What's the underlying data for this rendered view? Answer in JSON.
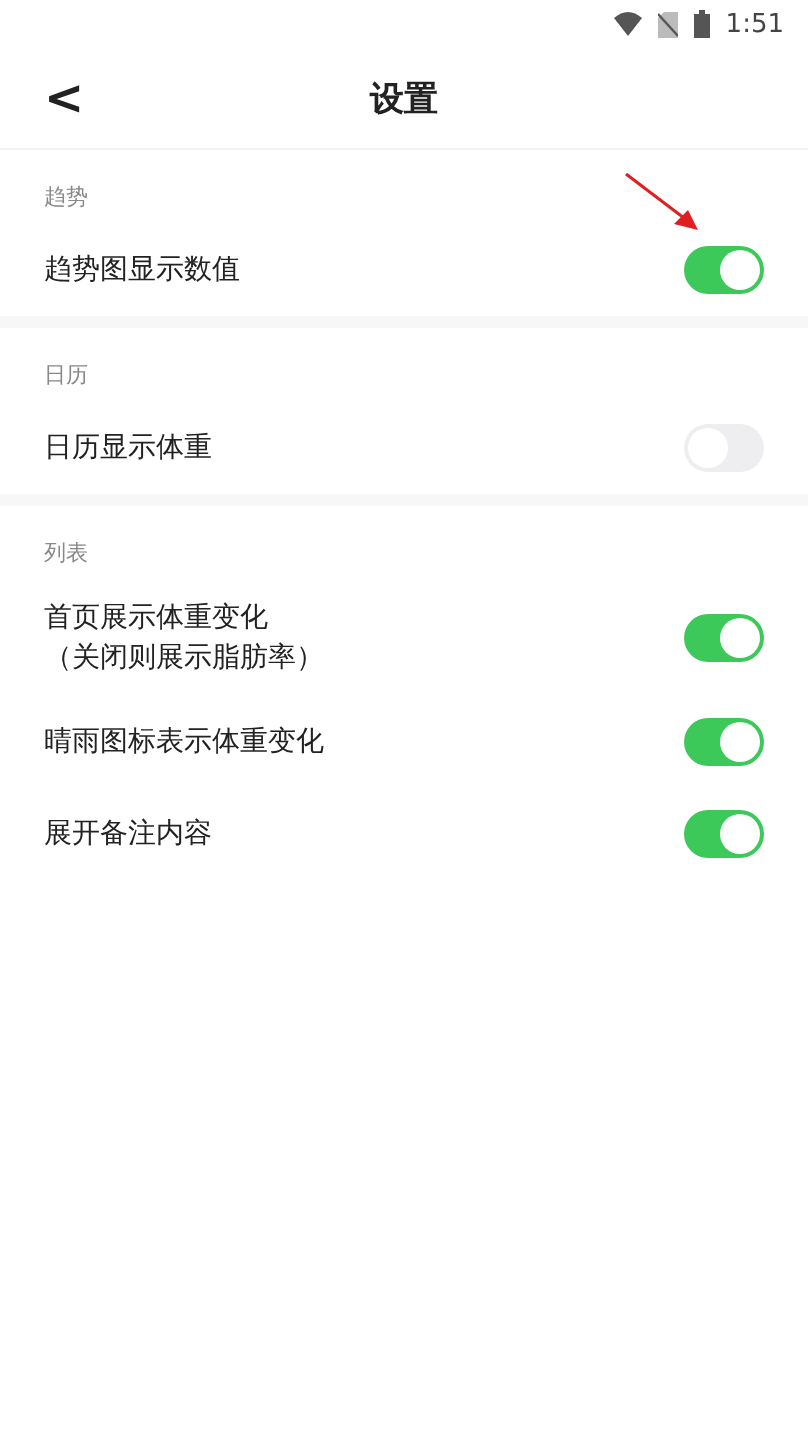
{
  "status_bar": {
    "time": "1:51"
  },
  "header": {
    "back": "<",
    "title": "设置"
  },
  "sections": [
    {
      "title": "趋势",
      "items": [
        {
          "label": "趋势图显示数值",
          "on": true,
          "annotated": true
        }
      ]
    },
    {
      "title": "日历",
      "items": [
        {
          "label": "日历显示体重",
          "on": false
        }
      ]
    },
    {
      "title": "列表",
      "items": [
        {
          "label": "首页展示体重变化",
          "note": "（关闭则展示脂肪率）",
          "on": true
        },
        {
          "label": "晴雨图标表示体重变化",
          "on": true
        },
        {
          "label": "展开备注内容",
          "on": true
        }
      ]
    }
  ]
}
